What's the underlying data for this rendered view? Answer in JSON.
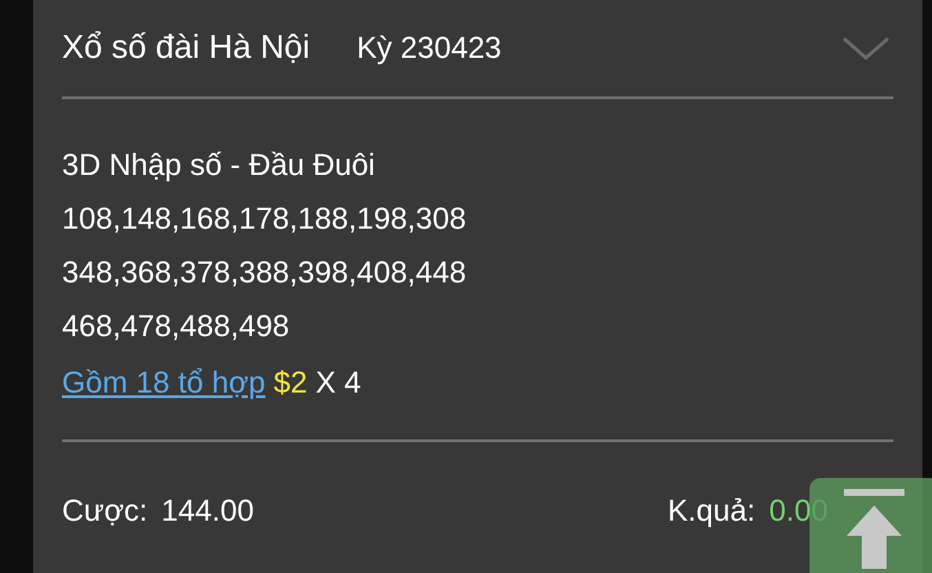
{
  "header": {
    "title": "Xổ số đài Hà Nội",
    "period": "Kỳ 230423",
    "expanded": true
  },
  "bet": {
    "type": "3D Nhập số - Đầu Đuôi",
    "number_lines": [
      "108,148,168,178,188,198,308",
      "348,368,378,388,398,408,448",
      "468,478,488,498"
    ],
    "combo_link": "Gồm 18 tổ hợp",
    "price": "$2",
    "multiplier": "X 4"
  },
  "footer": {
    "stake_label": "Cược:",
    "stake_value": "144.00",
    "result_label": "K.quả:",
    "result_value": "0.00"
  }
}
